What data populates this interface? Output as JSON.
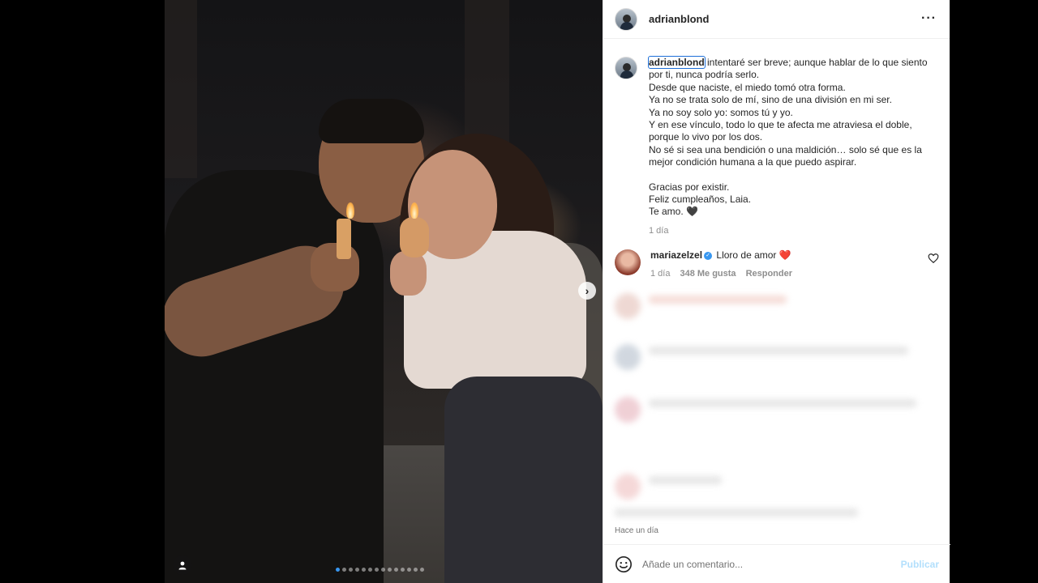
{
  "post": {
    "username": "adrianblond",
    "caption_lines": [
      "intentaré ser breve; aunque hablar de lo que siento por ti, nunca podría serlo.",
      "Desde que naciste, el miedo tomó otra forma.",
      "Ya no se trata solo de mí, sino de una división en mi ser.",
      "Ya no soy solo yo: somos tú y yo.",
      "Y en ese vínculo, todo lo que te afecta me atraviesa el doble, porque lo vivo por los dos.",
      "No sé si sea una bendición o una maldición… solo sé que es la mejor condición humana a la que puedo aspirar."
    ],
    "caption_end": [
      "Gracias por existir.",
      "Feliz cumpleaños, Laia.",
      "Te amo. 🖤"
    ],
    "caption_age": "1 día",
    "timestamp": "Hace un día",
    "carousel_total": 14,
    "carousel_current": 1
  },
  "comment": {
    "username": "mariazelzel",
    "text": "Lloro de amor ❤️",
    "age": "1 día",
    "likes": "348 Me gusta",
    "reply": "Responder"
  },
  "footer": {
    "placeholder": "Añade un comentario...",
    "publish": "Publicar"
  },
  "icons": {
    "more": "more-options-icon",
    "next": "carousel-next-icon",
    "tag": "tagged-user-icon",
    "heart": "heart-icon",
    "emoji": "emoji-icon"
  }
}
